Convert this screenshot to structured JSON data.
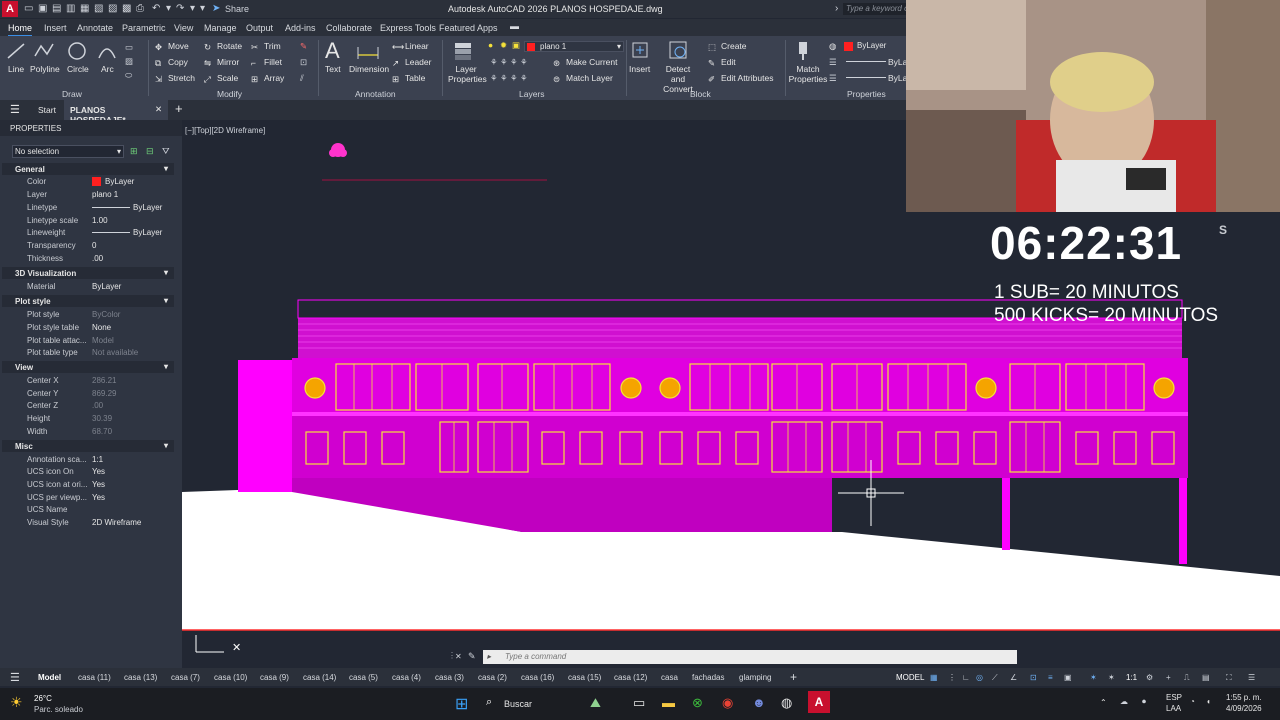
{
  "title_bar": {
    "logo": "A",
    "share": "Share",
    "title": "Autodesk AutoCAD 2026   PLANOS HOSPEDAJE.dwg",
    "search_placeholder": "Type a keyword or..."
  },
  "menu_tabs": [
    "Home",
    "Insert",
    "Annotate",
    "Parametric",
    "View",
    "Manage",
    "Output",
    "Add-ins",
    "Collaborate",
    "Express Tools",
    "Featured Apps"
  ],
  "ribbon": {
    "draw": {
      "line": "Line",
      "polyline": "Polyline",
      "circle": "Circle",
      "arc": "Arc",
      "label": "Draw"
    },
    "modify": {
      "move": "Move",
      "rotate": "Rotate",
      "trim": "Trim",
      "copy": "Copy",
      "mirror": "Mirror",
      "fillet": "Fillet",
      "stretch": "Stretch",
      "scale": "Scale",
      "array": "Array",
      "label": "Modify"
    },
    "annotation": {
      "text": "Text",
      "dimension": "Dimension",
      "linear": "Linear",
      "leader": "Leader",
      "table": "Table",
      "label": "Annotation"
    },
    "layers": {
      "layer_properties": "Layer Properties",
      "current_layer": "plano 1",
      "make_current": "Make Current",
      "match_layer": "Match Layer",
      "label": "Layers"
    },
    "block": {
      "insert": "Insert",
      "detect_convert": "Detect and Convert",
      "create": "Create",
      "edit": "Edit",
      "edit_attributes": "Edit Attributes",
      "label": "Block"
    },
    "properties": {
      "match_properties": "Match Properties",
      "color": "ByLayer",
      "linetype": "ByLa",
      "lineweight": "ByLa",
      "label": "Properties"
    }
  },
  "doc_tabs": {
    "start": "Start",
    "file": "PLANOS HOSPEDAJE*"
  },
  "properties_panel": {
    "title": "PROPERTIES",
    "selection": "No selection",
    "general": {
      "header": "General",
      "rows": [
        {
          "k": "Color",
          "v": "ByLayer"
        },
        {
          "k": "Layer",
          "v": "plano 1"
        },
        {
          "k": "Linetype",
          "v": "ByLayer"
        },
        {
          "k": "Linetype scale",
          "v": "1.00"
        },
        {
          "k": "Lineweight",
          "v": "ByLayer"
        },
        {
          "k": "Transparency",
          "v": "0"
        },
        {
          "k": "Thickness",
          "v": ".00"
        }
      ]
    },
    "viz": {
      "header": "3D Visualization",
      "rows": [
        {
          "k": "Material",
          "v": "ByLayer"
        }
      ]
    },
    "plot": {
      "header": "Plot style",
      "rows": [
        {
          "k": "Plot style",
          "v": "ByColor"
        },
        {
          "k": "Plot style table",
          "v": "None"
        },
        {
          "k": "Plot table attac...",
          "v": "Model"
        },
        {
          "k": "Plot table type",
          "v": "Not available"
        }
      ]
    },
    "view": {
      "header": "View",
      "rows": [
        {
          "k": "Center X",
          "v": "286.21"
        },
        {
          "k": "Center Y",
          "v": "869.29"
        },
        {
          "k": "Center Z",
          "v": ".00"
        },
        {
          "k": "Height",
          "v": "30.39"
        },
        {
          "k": "Width",
          "v": "68.70"
        }
      ]
    },
    "misc": {
      "header": "Misc",
      "rows": [
        {
          "k": "Annotation sca...",
          "v": "1:1"
        },
        {
          "k": "UCS icon On",
          "v": "Yes"
        },
        {
          "k": "UCS icon at ori...",
          "v": "Yes"
        },
        {
          "k": "UCS per viewp...",
          "v": "Yes"
        },
        {
          "k": "UCS Name",
          "v": ""
        },
        {
          "k": "Visual Style",
          "v": "2D Wireframe"
        }
      ]
    }
  },
  "viewport": {
    "label": "[−][Top][2D Wireframe]"
  },
  "command_line": {
    "placeholder": "Type a command"
  },
  "layout_tabs": [
    "Model",
    "casa (11)",
    "casa (13)",
    "casa (7)",
    "casa (10)",
    "casa (9)",
    "casa (14)",
    "casa (5)",
    "casa (4)",
    "casa (3)",
    "casa (2)",
    "casa (16)",
    "casa (15)",
    "casa (12)",
    "casa",
    "fachadas",
    "glamping"
  ],
  "status": {
    "mode": "MODEL",
    "scale": "1:1"
  },
  "taskbar": {
    "weather_temp": "26°C",
    "weather_desc": "Parc. soleado",
    "search": "Buscar",
    "lang1": "ESP",
    "lang2": "LAA",
    "time": "1:55 p. m.",
    "date": "4/09/2026"
  },
  "overlay": {
    "timer": "06:22:31",
    "timer_suffix": "S",
    "line1": "1 SUB= 20 MINUTOS",
    "line2": "500 KICKS= 20 MINUTOS"
  },
  "colors": {
    "magenta": "#ff00ff",
    "yellow": "#f5e13a",
    "accent": "#3a8ee6",
    "viewport_bg": "#222733"
  }
}
